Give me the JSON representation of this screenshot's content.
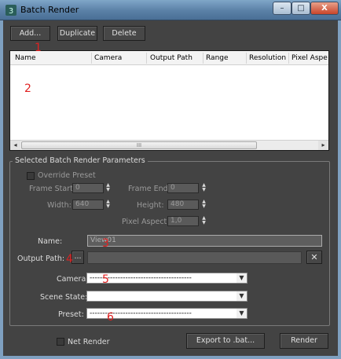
{
  "window": {
    "title": "Batch Render",
    "controls": {
      "minimize": "–",
      "maximize": "□",
      "close": "X"
    }
  },
  "toolbar": {
    "add_label": "Add...",
    "duplicate_label": "Duplicate",
    "delete_label": "Delete"
  },
  "job_list": {
    "columns": [
      "Name",
      "Camera",
      "Output Path",
      "Range",
      "Resolution",
      "Pixel Aspec"
    ],
    "scroll_thumb": "III",
    "scroll_left": "◂",
    "scroll_right": "▸"
  },
  "params": {
    "group_title": "Selected Batch Render Parameters",
    "override_preset": "Override Preset",
    "frame_start_label": "Frame Start:",
    "frame_start_value": "0",
    "frame_end_label": "Frame End:",
    "frame_end_value": "0",
    "width_label": "Width:",
    "width_value": "640",
    "height_label": "Height:",
    "height_value": "480",
    "pixel_aspect_label": "Pixel Aspect:",
    "pixel_aspect_value": "1,0",
    "name_label": "Name:",
    "name_value": "View01",
    "output_path_label": "Output Path:",
    "output_browse": "...",
    "output_clear": "✕",
    "camera_label": "Camera:",
    "camera_value": "----------------------------------------",
    "scene_state_label": "Scene State:",
    "scene_state_value": "",
    "preset_label": "Preset:",
    "preset_value": "----------------------------------------"
  },
  "footer": {
    "net_render": "Net Render",
    "export_label": "Export to .bat...",
    "render_label": "Render"
  },
  "annotations": [
    "1",
    "2",
    "3",
    "4",
    "5",
    "6"
  ],
  "colors": {
    "title_bar": "#5a80a6",
    "window_bg": "#434343",
    "annotation": "#e02020"
  },
  "icons": {
    "app": "max-teapot-icon",
    "spinner": "spinner-arrows-icon",
    "dropdown": "chevron-down-icon"
  }
}
